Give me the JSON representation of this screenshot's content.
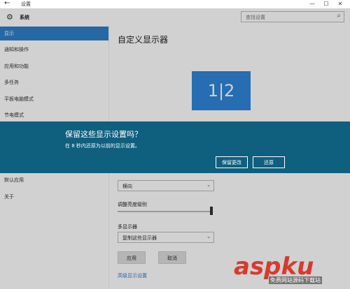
{
  "window": {
    "title": "设置",
    "back": "←",
    "minimize": "—",
    "maximize": "☐",
    "close": "✕"
  },
  "header": {
    "section": "系统",
    "search_placeholder": "查找设置",
    "search_icon": "search-icon"
  },
  "sidebar": {
    "items": [
      {
        "label": "显示",
        "active": true
      },
      {
        "label": "通知和操作"
      },
      {
        "label": "应用和功能"
      },
      {
        "label": "多任务"
      },
      {
        "label": "平板电脑模式"
      },
      {
        "label": "节电模式"
      },
      {
        "label": "默认应用"
      },
      {
        "label": "关于"
      }
    ]
  },
  "main": {
    "title": "自定义显示器",
    "monitor_label": "1|2",
    "orientation_value": "横向",
    "brightness_label": "调整亮度级别",
    "multi_label": "多显示器",
    "multi_value": "复制这些显示器",
    "apply": "应用",
    "cancel": "取消",
    "advanced_link": "高级显示设置",
    "brightness_level": 1.0
  },
  "dialog": {
    "title": "保留这些显示设置吗？",
    "message": "在 8 秒内还原为以前的显示设置。",
    "keep": "保留更改",
    "revert": "还原"
  },
  "watermark": {
    "brand": "aspku",
    "tagline": "免费网站源码下载站"
  },
  "colors": {
    "accent": "#2f7fc8",
    "dialog_bg": "#0f5f7e",
    "monitor": "#2f86d8",
    "watermark": "#d73a2f"
  }
}
